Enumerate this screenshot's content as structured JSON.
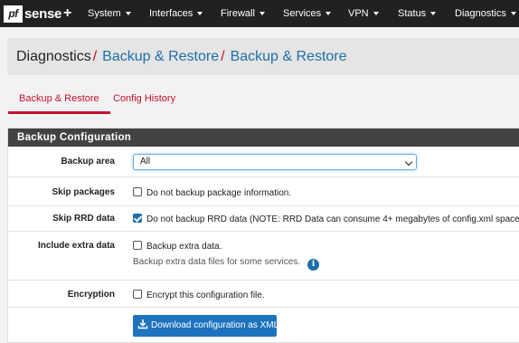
{
  "navbar": {
    "logo_box": "pf",
    "logo_text": "sense",
    "logo_plus": "+",
    "items": [
      {
        "label": "System"
      },
      {
        "label": "Interfaces"
      },
      {
        "label": "Firewall"
      },
      {
        "label": "Services"
      },
      {
        "label": "VPN"
      },
      {
        "label": "Status"
      },
      {
        "label": "Diagnostics"
      }
    ]
  },
  "breadcrumb": {
    "items": [
      "Diagnostics",
      "Backup & Restore",
      "Backup & Restore"
    ],
    "separator": "/"
  },
  "tabs": [
    {
      "label": "Backup & Restore",
      "active": true
    },
    {
      "label": "Config History",
      "active": false
    }
  ],
  "panel": {
    "title": "Backup Configuration",
    "backup_area": {
      "label": "Backup area",
      "value": "All"
    },
    "skip_packages": {
      "label": "Skip packages",
      "text": "Do not backup package information.",
      "checked": false
    },
    "skip_rrd": {
      "label": "Skip RRD data",
      "text": "Do not backup RRD data (NOTE: RRD Data can consume 4+ megabytes of config.xml space!)",
      "checked": true
    },
    "include_extra": {
      "label": "Include extra data",
      "text": "Backup extra data.",
      "help": "Backup extra data files for some services.",
      "checked": false
    },
    "encryption": {
      "label": "Encryption",
      "text": "Encrypt this configuration file.",
      "checked": false
    },
    "download_button": "Download configuration as XML"
  },
  "colors": {
    "accent_red": "#c41230",
    "link_blue": "#1e6fa8",
    "button_blue": "#1e73be",
    "navbar": "#212121",
    "panel_header": "#424242"
  },
  "icons": {
    "info": "info-icon",
    "download": "download-icon",
    "caret": "caret-down-icon"
  }
}
